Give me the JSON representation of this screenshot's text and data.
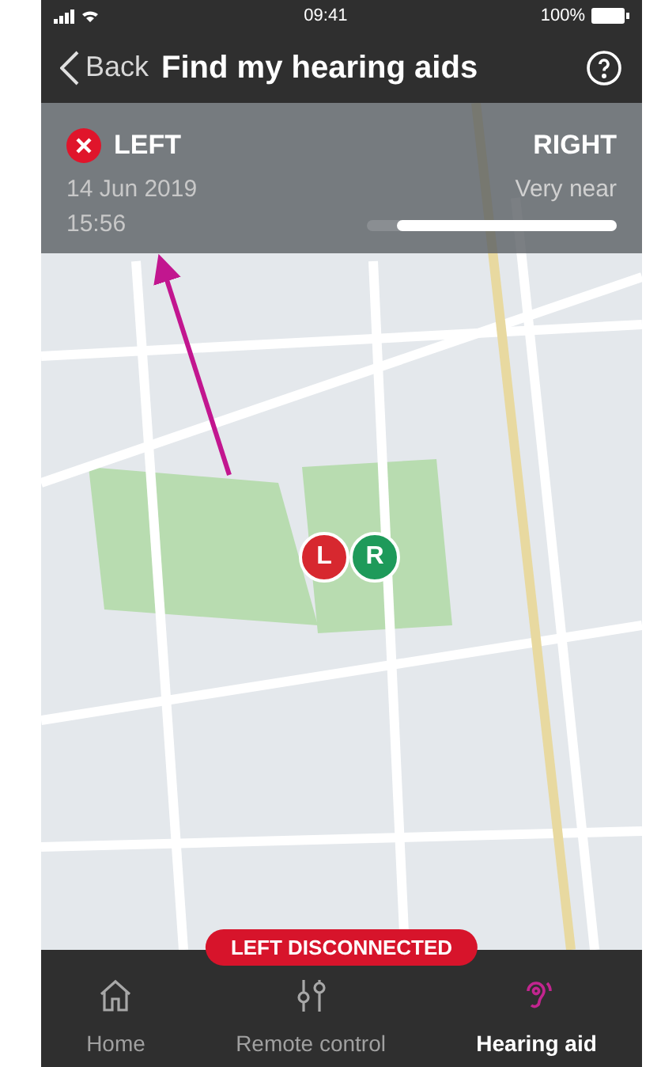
{
  "status_bar": {
    "time": "09:41",
    "battery": "100%"
  },
  "nav": {
    "back": "Back",
    "title": "Find my hearing aids"
  },
  "devices": [
    {
      "side": "LEFT",
      "connected": false,
      "date": "14 Jun 2019",
      "time": "15:56"
    },
    {
      "side": "RIGHT",
      "connected": true,
      "distance": "Very near",
      "level": 0.88
    }
  ],
  "map": {
    "markers": [
      {
        "label": "L",
        "color": "#d7282f"
      },
      {
        "label": "R",
        "color": "#1e9a5a"
      }
    ]
  },
  "alert": "LEFT DISCONNECTED",
  "tabs": [
    {
      "label": "Home",
      "kind": "home",
      "selected": false
    },
    {
      "label": "Remote control",
      "kind": "sliders",
      "selected": false
    },
    {
      "label": "Hearing aid",
      "kind": "ear",
      "selected": true
    }
  ]
}
